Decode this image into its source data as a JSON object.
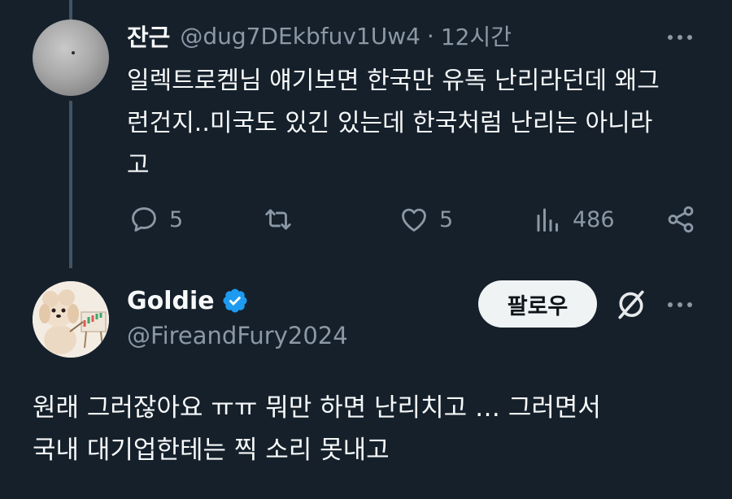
{
  "reply_tweet": {
    "name": "잔근",
    "handle": "@dug7DEkbfuv1Uw4",
    "separator": "·",
    "time": "12시간",
    "text": "일렉트로켐님 얘기보면 한국만 유독 난리라던데 왜그\n런건지..미국도 있긴 있는데 한국처럼 난리는 아니라\n고",
    "actions": {
      "replies": "5",
      "retweets": "",
      "likes": "5",
      "views": "486"
    },
    "avatar_icon": "gray-sphere-avatar"
  },
  "main_tweet": {
    "name": "Goldie",
    "verified_icon": "verified-badge-icon",
    "handle": "@FireandFury2024",
    "follow_label": "팔로우",
    "text": "원래 그러잖아요 ㅠㅠ 뭐만 하면 난리치고 … 그러면서\n국내 대기업한테는 찍 소리 못내고",
    "avatar_icon": "dog-with-chart-avatar"
  },
  "colors": {
    "background": "#15202b",
    "primary_text": "#f7f9f9",
    "secondary_text": "#8b98a5",
    "thread_line": "#425364",
    "verified_blue": "#1d9bf0",
    "follow_button_bg": "#eff3f4"
  }
}
